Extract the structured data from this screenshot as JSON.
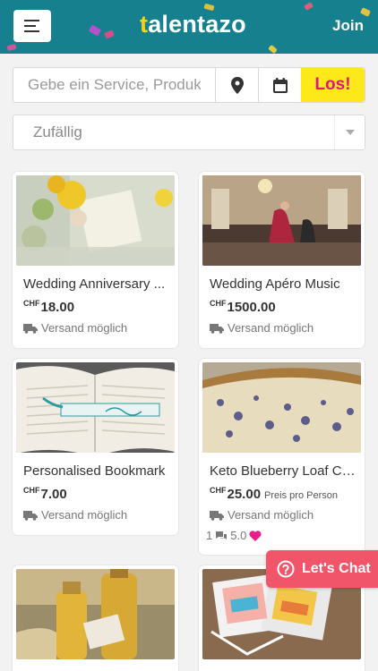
{
  "header": {
    "logo_first": "t",
    "logo_rest": "alentazo",
    "join_label": "Join",
    "menu_icon": "hamburger-menu-icon",
    "background": "#17808e"
  },
  "search": {
    "placeholder": "Gebe ein Service, Produkt",
    "location_icon": "map-pin-icon",
    "calendar_icon": "calendar-icon",
    "go_label": "Los!"
  },
  "sort": {
    "selected": "Zufällig",
    "arrow_icon": "caret-down-icon"
  },
  "listings": [
    {
      "title": "Wedding Anniversary ...",
      "currency": "CHF",
      "price": "18.00",
      "shipping": "Versand möglich"
    },
    {
      "title": "Wedding Apéro Music",
      "currency": "CHF",
      "price": "1500.00",
      "shipping": "Versand möglich"
    },
    {
      "title": "Personalised Bookmark",
      "currency": "CHF",
      "price": "7.00",
      "shipping": "Versand möglich"
    },
    {
      "title": "Keto Blueberry Loaf Ca...",
      "currency": "CHF",
      "price": "25.00",
      "price_note": "Preis pro Person",
      "shipping": "Versand möglich",
      "review_count": "1",
      "rating": "5.0"
    },
    {
      "title": "",
      "currency": "",
      "price": "",
      "shipping": ""
    },
    {
      "title": "",
      "currency": "",
      "price": "",
      "shipping": ""
    }
  ],
  "chat": {
    "label": "Let's Chat",
    "icon": "help-circle-icon"
  },
  "colors": {
    "accent_yellow": "#fde81a",
    "accent_pink": "#e3157f",
    "chat": "#f0556a",
    "heart": "#e91e8c"
  }
}
